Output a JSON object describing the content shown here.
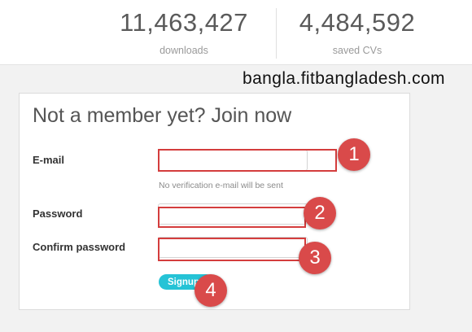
{
  "stats": [
    {
      "value": "11,463,427",
      "label": "downloads"
    },
    {
      "value": "4,484,592",
      "label": "saved CVs"
    }
  ],
  "watermark": "bangla.fitbangladesh.com",
  "form": {
    "title": "Not a member yet? Join now",
    "email": {
      "label": "E-mail",
      "value": "",
      "placeholder": ""
    },
    "email_hint": "No verification e-mail will be sent",
    "password": {
      "label": "Password",
      "value": "",
      "placeholder": ""
    },
    "confirm_password": {
      "label": "Confirm password",
      "value": "",
      "placeholder": ""
    },
    "signup_label": "Signup"
  },
  "annotations": [
    "1",
    "2",
    "3",
    "4"
  ],
  "colors": {
    "accent": "#25c3d6",
    "annotation_red": "#d94a4a",
    "highlight_border": "#d43d3d"
  }
}
